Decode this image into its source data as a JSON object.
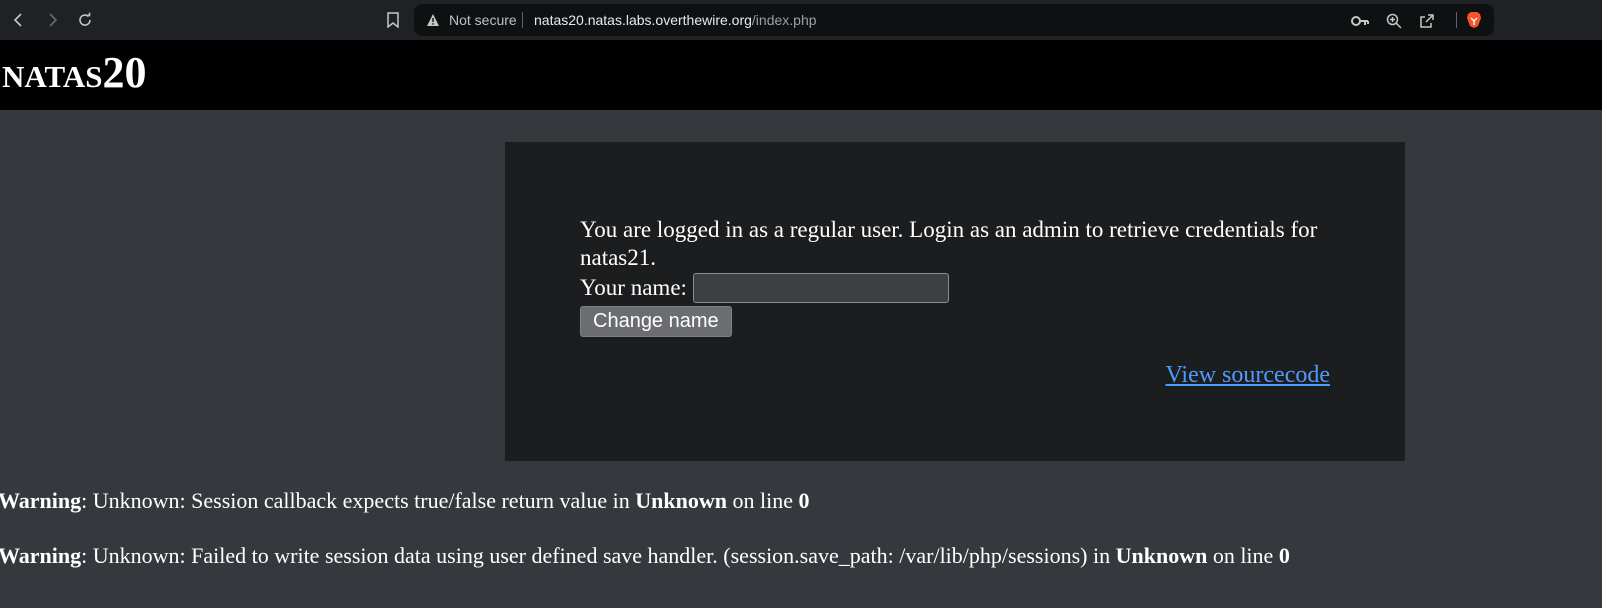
{
  "browser": {
    "security_label": "Not secure",
    "url_host": "natas20.natas.labs.overthewire.org",
    "url_path": "/index.php",
    "icons": {
      "back": "back-arrow-icon",
      "forward": "forward-arrow-icon",
      "reload": "reload-icon",
      "bookmark": "bookmark-icon",
      "warning": "warning-triangle-icon",
      "key": "key-icon",
      "zoom": "zoom-icon",
      "share": "share-icon",
      "brave": "brave-lion-icon"
    }
  },
  "header": {
    "title": "natas20"
  },
  "main": {
    "message": "You are logged in as a regular user. Login as an admin to retrieve credentials for natas21.",
    "name_label": "Your name:",
    "name_value": "",
    "submit_label": "Change name",
    "source_link": "View sourcecode"
  },
  "warnings": [
    {
      "label": "Warning",
      "text_before": ": Unknown: Session callback expects true/false return value in ",
      "file": "Unknown",
      "text_middle": " on line ",
      "line": "0"
    },
    {
      "label": "Warning",
      "text_before": ": Unknown: Failed to write session data using user defined save handler. (session.save_path: /var/lib/php/sessions) in ",
      "file": "Unknown",
      "text_middle": " on line ",
      "line": "0"
    }
  ],
  "colors": {
    "page_background": "#35393e",
    "content_background": "#1c1d1f",
    "header_background": "#000000",
    "link": "#4e9bff"
  }
}
